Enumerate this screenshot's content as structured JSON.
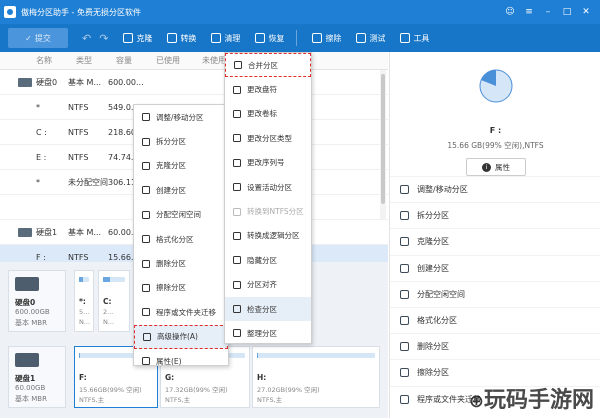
{
  "app": {
    "title": "傲梅分区助手 - 免费无损分区软件"
  },
  "window_controls": [
    "☺",
    "≡",
    "–",
    "□",
    "✕"
  ],
  "toolbar": {
    "submit": "提交",
    "items": [
      "克隆",
      "转换",
      "清理",
      "恢复",
      "擦除",
      "测试",
      "工具"
    ]
  },
  "columns": [
    "名称",
    "类型",
    "容量",
    "已使用",
    "未使用"
  ],
  "disk_rows": [
    {
      "name": "硬盘0",
      "type": "基本 M...",
      "cap": "600.00...",
      "disk": true,
      "sel": false
    },
    {
      "name": "*",
      "type": "NTFS",
      "cap": "549.0...",
      "disk": false,
      "sel": false
    },
    {
      "name": "C :",
      "type": "NTFS",
      "cap": "218.60...",
      "disk": false,
      "sel": false
    },
    {
      "name": "E :",
      "type": "NTFS",
      "cap": "74.74...",
      "disk": false,
      "sel": false
    },
    {
      "name": "*",
      "type": "未分配空间",
      "cap": "306.11...",
      "disk": false,
      "sel": false
    },
    {
      "name": "",
      "type": "",
      "cap": "",
      "disk": false,
      "sel": false
    },
    {
      "name": "硬盘1",
      "type": "基本 M...",
      "cap": "60.00...",
      "disk": true,
      "sel": false
    },
    {
      "name": "F :",
      "type": "NTFS",
      "cap": "15.66...",
      "disk": false,
      "sel": true
    }
  ],
  "disk_cards": [
    {
      "name": "硬盘0",
      "cap": "600.00GB",
      "type": "基本 MBR"
    },
    {
      "name": "硬盘1",
      "cap": "60.00GB",
      "type": "基本 MBR"
    }
  ],
  "partitions_disk0": [
    {
      "l1": "*:",
      "l2": "5...",
      "l3": "N..."
    },
    {
      "l1": "C:",
      "l2": "2...",
      "l3": "N..."
    }
  ],
  "partitions_disk1": [
    {
      "l1": "F:",
      "l2": "15.66GB(99% 空闲)",
      "l3": "NTFS,主",
      "fill": 0.01
    },
    {
      "l1": "G:",
      "l2": "17.32GB(99% 空闲)",
      "l3": "NTFS,主",
      "fill": 0.01
    },
    {
      "l1": "H:",
      "l2": "27.02GB(99% 空闲)",
      "l3": "NTFS,主",
      "fill": 0.01
    }
  ],
  "right_panel": {
    "name": "F :",
    "info": "15.66 GB(99% 空闲),NTFS",
    "prop_button": "属性",
    "ops": [
      "调整/移动分区",
      "拆分分区",
      "克隆分区",
      "创建分区",
      "分配空闲空间",
      "格式化分区",
      "删除分区",
      "擦除分区",
      "程序或文件夹迁移"
    ]
  },
  "context_menu": {
    "items": [
      "调整/移动分区",
      "拆分分区",
      "克隆分区",
      "创建分区",
      "分配空闲空间",
      "格式化分区",
      "删除分区",
      "擦除分区",
      "程序或文件夹迁移",
      "高级操作(A)",
      "属性(E)"
    ]
  },
  "submenu": {
    "items": [
      "合并分区",
      "更改盘符",
      "更改卷标",
      "更改分区类型",
      "更改序列号",
      "设置活动分区",
      "转换到NTFS分区",
      "转换成逻辑分区",
      "隐藏分区",
      "分区对齐",
      "检查分区",
      "整理分区"
    ]
  },
  "watermark": {
    "pre": "⊕",
    "text": "玩码手游网"
  }
}
